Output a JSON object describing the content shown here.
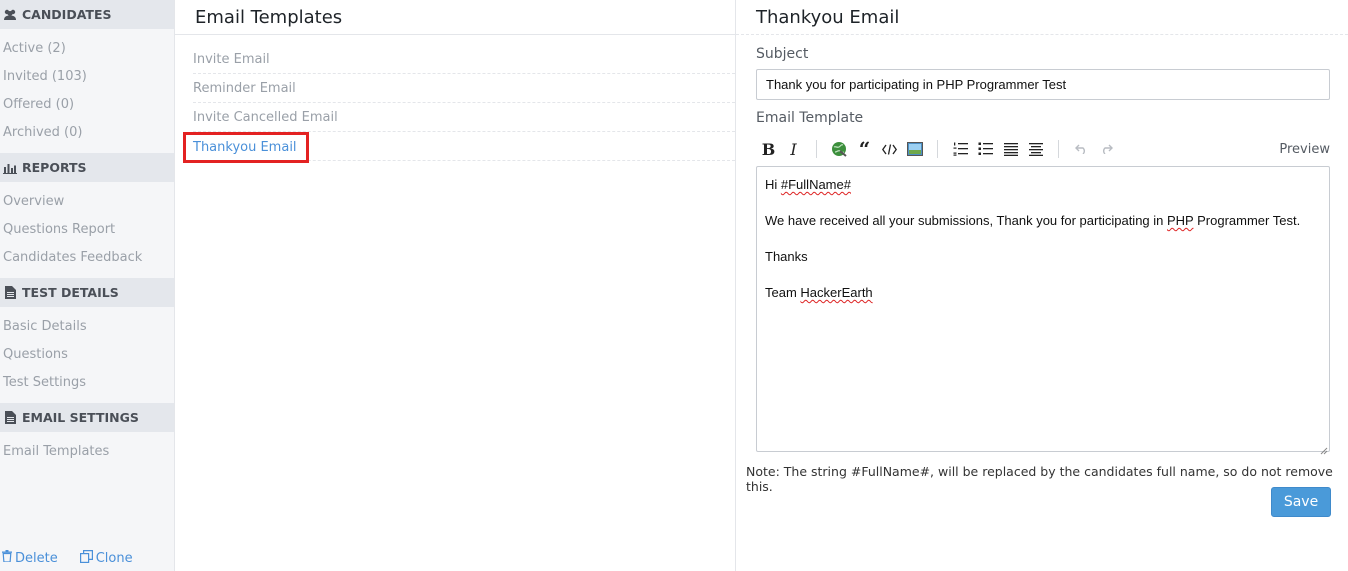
{
  "sidebar": {
    "sections": [
      {
        "title": "CANDIDATES",
        "icon": "users-icon",
        "items": [
          "Active (2)",
          "Invited (103)",
          "Offered (0)",
          "Archived (0)"
        ]
      },
      {
        "title": "REPORTS",
        "icon": "bar-chart-icon",
        "items": [
          "Overview",
          "Questions Report",
          "Candidates Feedback"
        ]
      },
      {
        "title": "TEST DETAILS",
        "icon": "document-icon",
        "items": [
          "Basic Details",
          "Questions",
          "Test Settings"
        ]
      },
      {
        "title": "EMAIL SETTINGS",
        "icon": "document-icon",
        "items": [
          "Email Templates"
        ]
      }
    ],
    "footer": {
      "delete_label": "Delete",
      "clone_label": "Clone"
    }
  },
  "templates": {
    "title": "Email Templates",
    "items": [
      "Invite Email",
      "Reminder Email",
      "Invite Cancelled Email",
      "Thankyou Email"
    ],
    "active_index": 3
  },
  "detail": {
    "title": "Thankyou Email",
    "subject_label": "Subject",
    "subject_value": "Thank you for participating in PHP Programmer Test",
    "template_label": "Email Template",
    "preview_label": "Preview",
    "body": {
      "greeting_prefix": "Hi ",
      "greeting_token": "#FullName#",
      "line1_a": "We have received all your submissions, Thank you for participating in ",
      "line1_php": "PHP",
      "line1_b": " Programmer Test.",
      "thanks": "Thanks",
      "team_prefix": "Team ",
      "team_name": "HackerEarth"
    },
    "note": "Note: The string #FullName#, will be replaced by the candidates full name, so do not remove this.",
    "save_label": "Save"
  },
  "colors": {
    "accent": "#4a90d9",
    "highlight": "#e32222",
    "save": "#4a9ad9"
  }
}
